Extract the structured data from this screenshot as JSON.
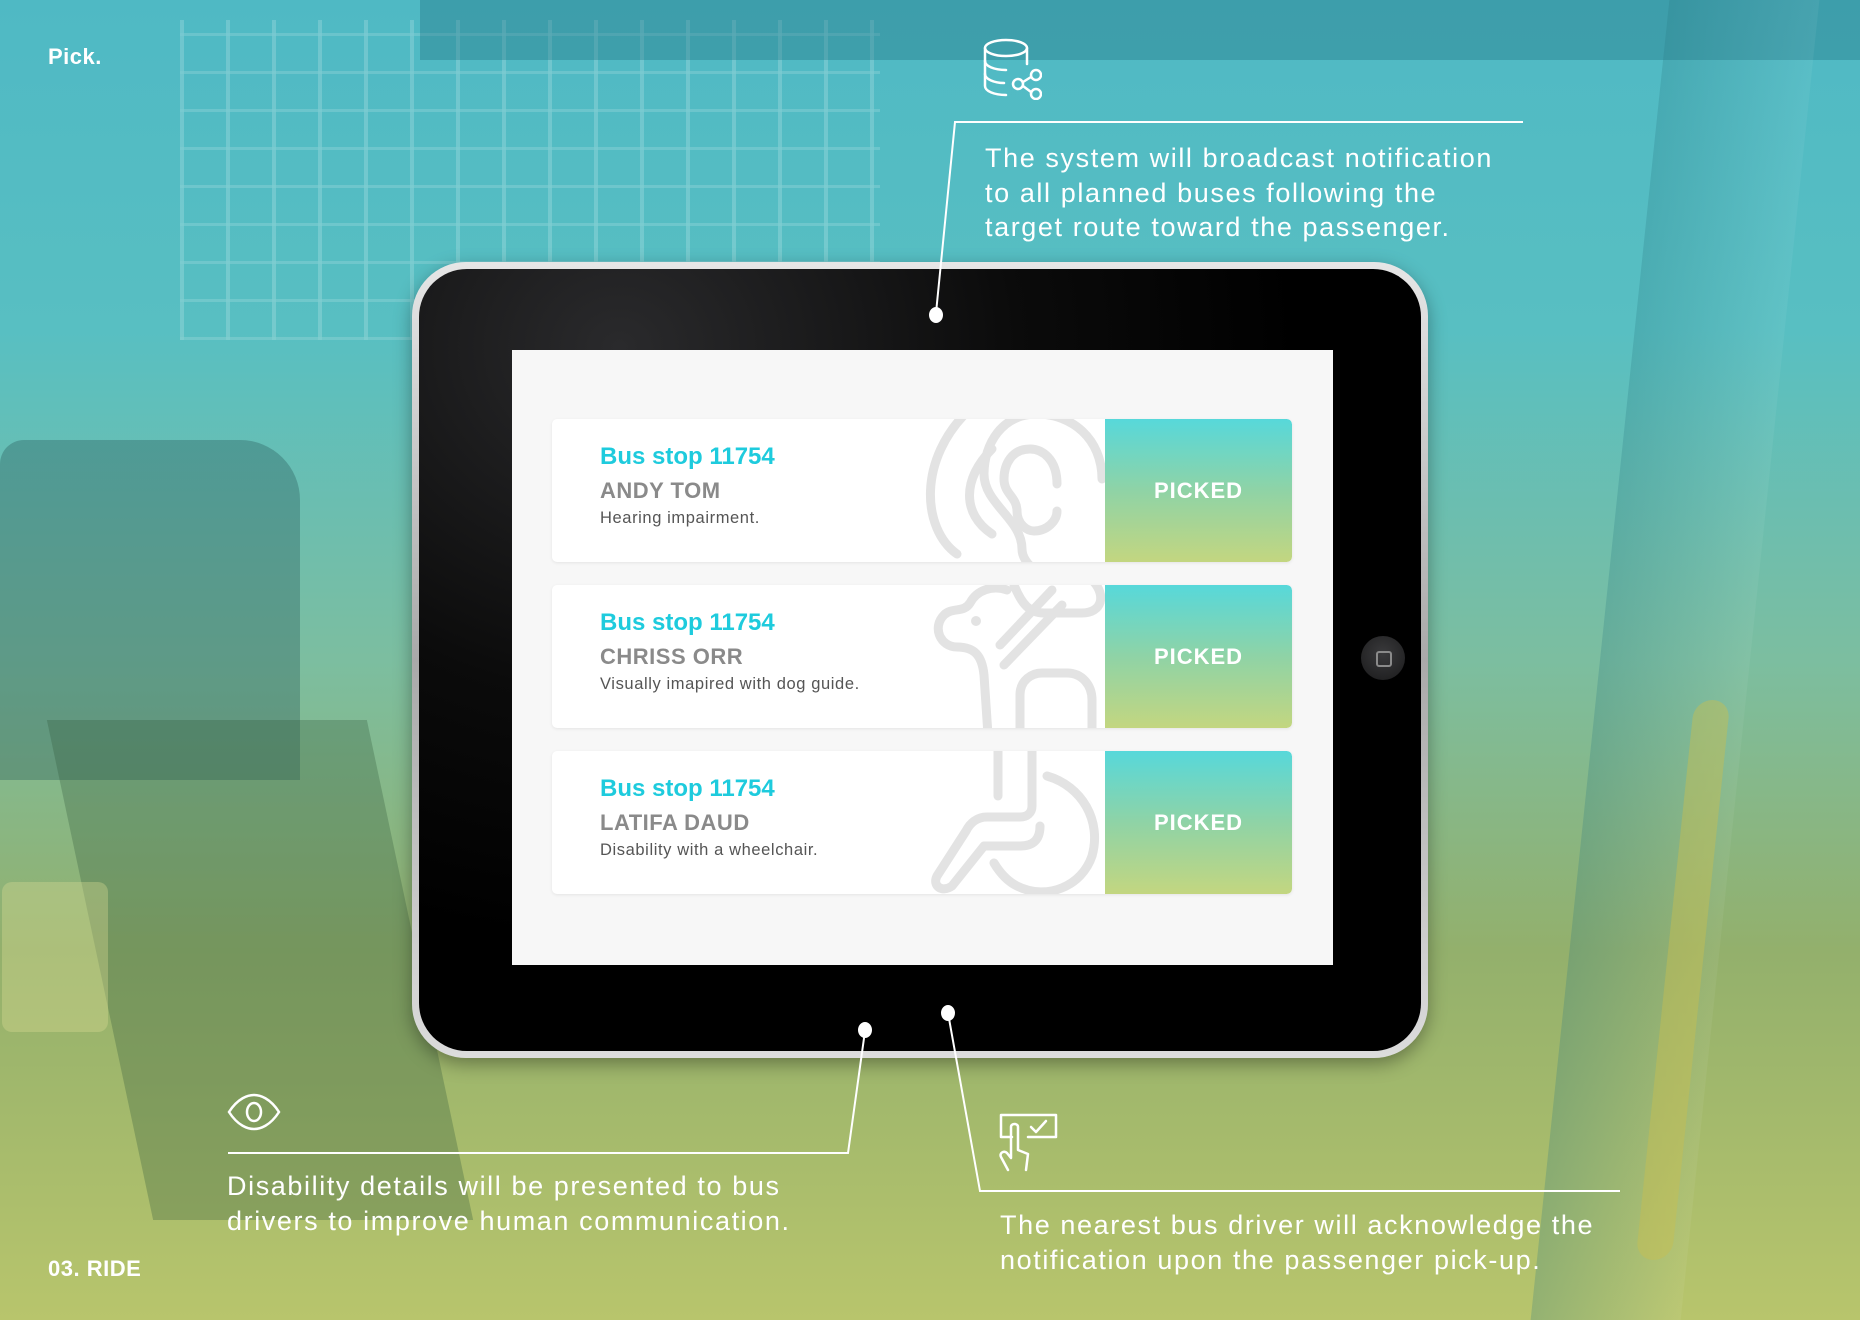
{
  "brand": "Pick.",
  "section": "03. RIDE",
  "callouts": {
    "top": {
      "icon": "database-share-icon",
      "lines": [
        "The system will broadcast notification",
        "to all planned buses following the",
        "target route toward the passenger."
      ]
    },
    "bottom_left": {
      "icon": "eye-icon",
      "lines": [
        "Disability details will be presented to bus",
        "drivers to improve human communication."
      ]
    },
    "bottom_right": {
      "icon": "tap-check-icon",
      "lines": [
        "The nearest bus driver will acknowledge the",
        "notification upon the passenger pick-up."
      ]
    }
  },
  "screen": {
    "cards": [
      {
        "stop": "Bus stop 11754",
        "name": "ANDY TOM",
        "description": "Hearing impairment.",
        "watermark": "ear-icon",
        "action": "PICKED"
      },
      {
        "stop": "Bus stop 11754",
        "name": "CHRISS ORR",
        "description": "Visually imapired with dog guide.",
        "watermark": "guide-dog-icon",
        "action": "PICKED"
      },
      {
        "stop": "Bus stop 11754",
        "name": "LATIFA DAUD",
        "description": "Disability with a wheelchair.",
        "watermark": "wheelchair-icon",
        "action": "PICKED"
      }
    ]
  },
  "colors": {
    "accent": "#1ecbdd",
    "button_top": "#57d8da",
    "button_bottom": "#c3d680",
    "name_gray": "#8a8a8a"
  }
}
